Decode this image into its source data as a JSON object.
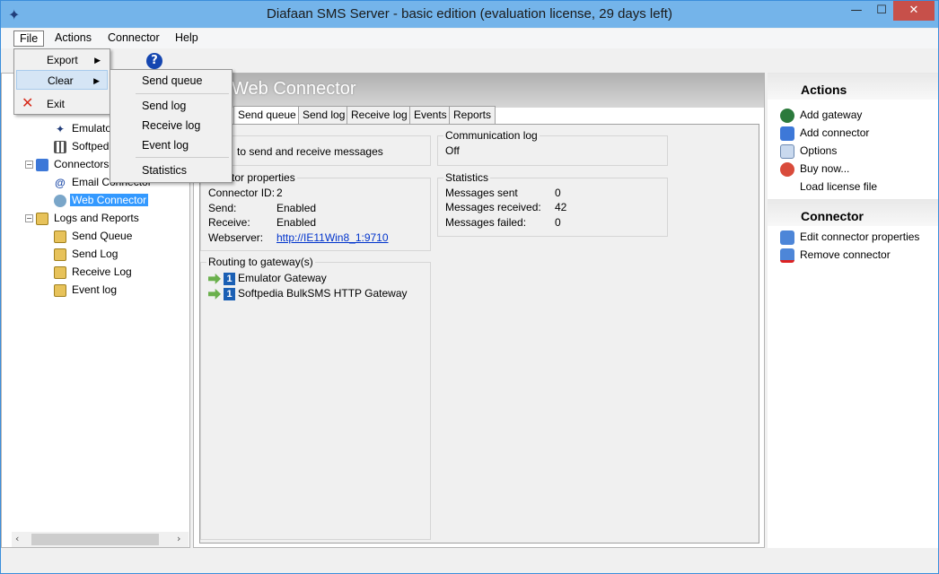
{
  "window": {
    "title": "Diafaan SMS Server - basic edition (evaluation license, 29 days left)",
    "min": "—",
    "max": "☐",
    "close": "✕"
  },
  "menubar": {
    "file": "File",
    "actions": "Actions",
    "connector": "Connector",
    "help": "Help"
  },
  "file_menu": {
    "export": "Export",
    "clear": "Clear",
    "exit": "Exit"
  },
  "clear_submenu": {
    "send_queue": "Send queue",
    "send_log": "Send log",
    "receive_log": "Receive log",
    "event_log": "Event log",
    "statistics": "Statistics"
  },
  "tree": {
    "emulator": "Emulator",
    "softpedia": "Softpedia",
    "connectors": "Connectors",
    "email_connector": "Email Connector",
    "web_connector": "Web Connector",
    "logs_reports": "Logs and Reports",
    "send_queue": "Send Queue",
    "send_log": "Send Log",
    "receive_log": "Receive Log",
    "event_log": "Event log"
  },
  "center": {
    "header_title": "Web Connector",
    "tabs": [
      "Send queue",
      "Send log",
      "Receive log",
      "Events",
      "Reports"
    ],
    "description": "to send and receive messages",
    "comm_log": {
      "title": "Communication log",
      "value": "Off"
    },
    "connector_props": {
      "title": "nnector properties",
      "id_label": "Connector ID:",
      "id_value": "2",
      "send_label": "Send:",
      "send_value": "Enabled",
      "receive_label": "Receive:",
      "receive_value": "Enabled",
      "webserver_label": "Webserver:",
      "webserver_value": "http://IE11Win8_1:9710"
    },
    "statistics": {
      "title": "Statistics",
      "sent_label": "Messages sent",
      "sent_value": "0",
      "received_label": "Messages received:",
      "received_value": "42",
      "failed_label": "Messages failed:",
      "failed_value": "0"
    },
    "routing": {
      "title": "Routing to gateway(s)",
      "gateways": [
        "Emulator Gateway",
        "Softpedia BulkSMS HTTP Gateway"
      ]
    }
  },
  "right": {
    "actions_header": "Actions",
    "actions": [
      "Add gateway",
      "Add connector",
      "Options",
      "Buy now...",
      "Load license file"
    ],
    "connector_header": "Connector",
    "connector_items": [
      "Edit connector properties",
      "Remove connector"
    ]
  }
}
